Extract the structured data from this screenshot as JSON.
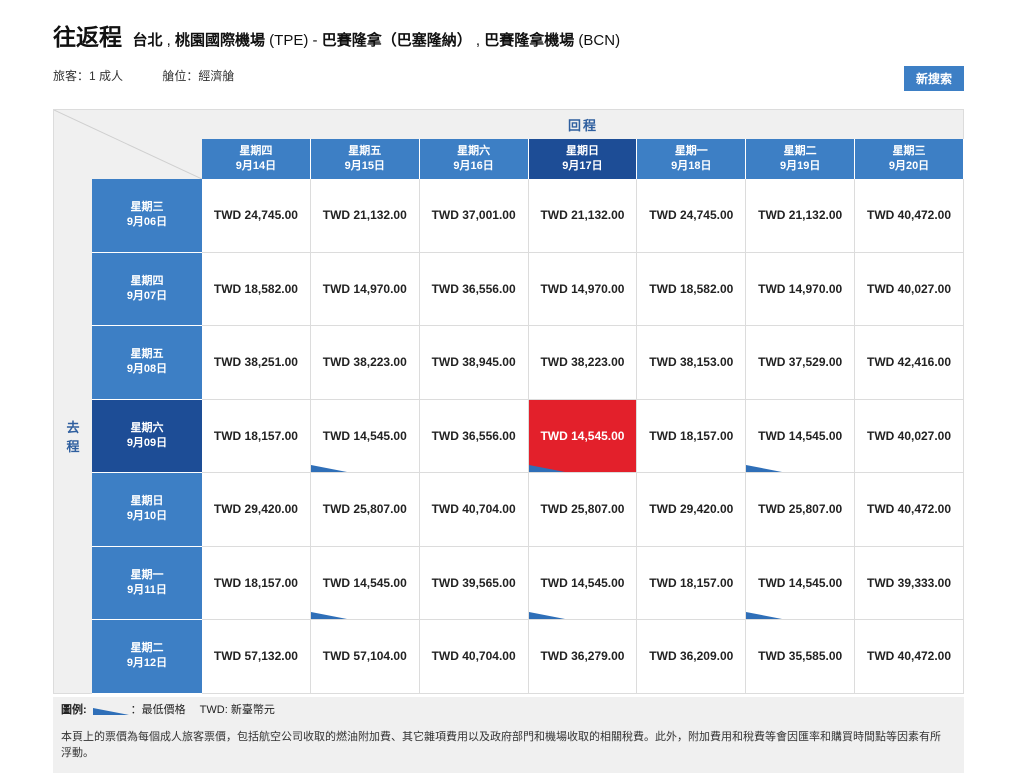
{
  "header": {
    "trip_type": "往返程",
    "origin_city": "台北",
    "origin_airport": "桃園國際機場",
    "origin_code": "(TPE)",
    "separator": "-",
    "dest_city": "巴賽隆拿（巴塞隆納）",
    "dest_airport": "巴賽隆拿機場",
    "dest_code": "(BCN)"
  },
  "meta": {
    "passengers": "旅客：1 成人",
    "cabin": "艙位：經濟艙"
  },
  "actions": {
    "new_search": "新搜索"
  },
  "grid": {
    "return_label": "回程",
    "depart_label_1": "去",
    "depart_label_2": "程",
    "return_dates": [
      {
        "weekday": "星期四",
        "date": "9月14日"
      },
      {
        "weekday": "星期五",
        "date": "9月15日"
      },
      {
        "weekday": "星期六",
        "date": "9月16日"
      },
      {
        "weekday": "星期日",
        "date": "9月17日"
      },
      {
        "weekday": "星期一",
        "date": "9月18日"
      },
      {
        "weekday": "星期二",
        "date": "9月19日"
      },
      {
        "weekday": "星期三",
        "date": "9月20日"
      }
    ],
    "depart_dates": [
      {
        "weekday": "星期三",
        "date": "9月06日"
      },
      {
        "weekday": "星期四",
        "date": "9月07日"
      },
      {
        "weekday": "星期五",
        "date": "9月08日"
      },
      {
        "weekday": "星期六",
        "date": "9月09日"
      },
      {
        "weekday": "星期日",
        "date": "9月10日"
      },
      {
        "weekday": "星期一",
        "date": "9月11日"
      },
      {
        "weekday": "星期二",
        "date": "9月12日"
      }
    ],
    "selected_return_index": 3,
    "selected_depart_index": 3,
    "prices": [
      [
        "TWD 24,745.00",
        "TWD 21,132.00",
        "TWD 37,001.00",
        "TWD 21,132.00",
        "TWD 24,745.00",
        "TWD 21,132.00",
        "TWD 40,472.00"
      ],
      [
        "TWD 18,582.00",
        "TWD 14,970.00",
        "TWD 36,556.00",
        "TWD 14,970.00",
        "TWD 18,582.00",
        "TWD 14,970.00",
        "TWD 40,027.00"
      ],
      [
        "TWD 38,251.00",
        "TWD 38,223.00",
        "TWD 38,945.00",
        "TWD 38,223.00",
        "TWD 38,153.00",
        "TWD 37,529.00",
        "TWD 42,416.00"
      ],
      [
        "TWD 18,157.00",
        "TWD 14,545.00",
        "TWD 36,556.00",
        "TWD 14,545.00",
        "TWD 18,157.00",
        "TWD 14,545.00",
        "TWD 40,027.00"
      ],
      [
        "TWD 29,420.00",
        "TWD 25,807.00",
        "TWD 40,704.00",
        "TWD 25,807.00",
        "TWD 29,420.00",
        "TWD 25,807.00",
        "TWD 40,472.00"
      ],
      [
        "TWD 18,157.00",
        "TWD 14,545.00",
        "TWD 39,565.00",
        "TWD 14,545.00",
        "TWD 18,157.00",
        "TWD 14,545.00",
        "TWD 39,333.00"
      ],
      [
        "TWD 57,132.00",
        "TWD 57,104.00",
        "TWD 40,704.00",
        "TWD 36,279.00",
        "TWD 36,209.00",
        "TWD 35,585.00",
        "TWD 40,472.00"
      ]
    ],
    "lowest_price_cells": [
      [
        3,
        1
      ],
      [
        3,
        3
      ],
      [
        3,
        5
      ],
      [
        5,
        1
      ],
      [
        5,
        3
      ],
      [
        5,
        5
      ]
    ]
  },
  "legend": {
    "label": "圖例:",
    "lowest_text": "：最低價格",
    "currency_text": "TWD: 新臺幣元",
    "note": "本頁上的票價為每個成人旅客票價，包括航空公司收取的燃油附加費、其它雜項費用以及政府部門和機場收取的相關稅費。此外，附加費用和稅費等會因匯率和購買時間點等因素有所浮動。"
  },
  "colors": {
    "header_blue": "#3d7fc5",
    "selected_blue": "#1d4d96",
    "selected_red": "#e3202b",
    "lowest_mark": "#2f6fb8"
  }
}
